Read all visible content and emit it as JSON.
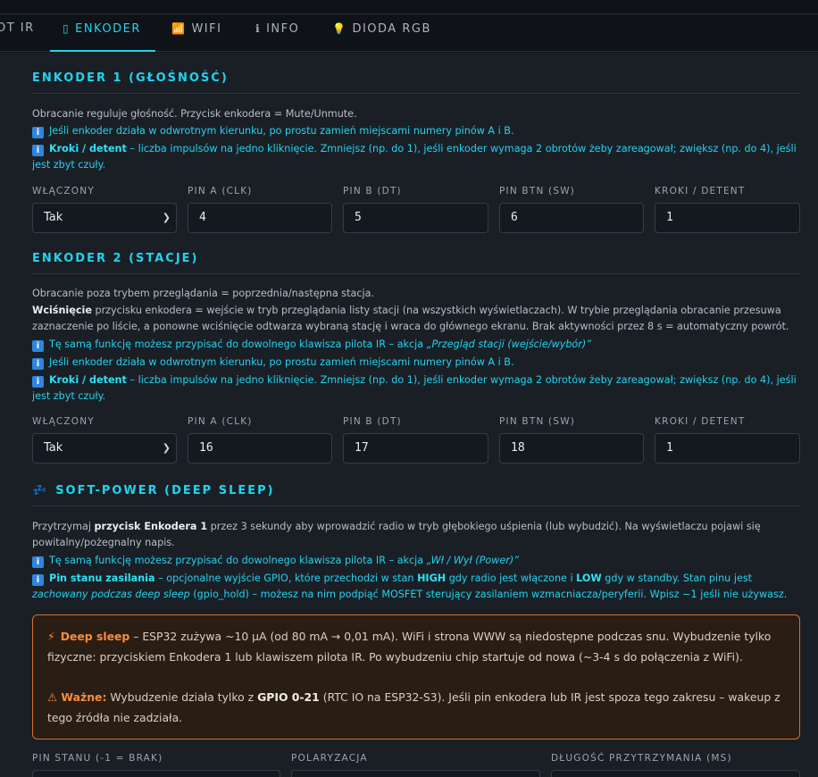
{
  "tabs": [
    {
      "label": "OT IR",
      "icon": ""
    },
    {
      "label": "ENKODER",
      "icon": "▯"
    },
    {
      "label": "WIFI",
      "icon": "📶"
    },
    {
      "label": "INFO",
      "icon": "ℹ"
    },
    {
      "label": "DIODA RGB",
      "icon": "💡"
    }
  ],
  "enc1": {
    "title": "ENKODER 1 (GŁOŚNOŚĆ)",
    "desc": "Obracanie reguluje głośność. Przycisk enkodera = Mute/Unmute.",
    "hint_reverse": "Jeśli enkoder działa w odwrotnym kierunku, po prostu zamień miejscami numery pinów A i B.",
    "hint_steps_bold": "Kroki / detent",
    "hint_steps": " – liczba impulsów na jedno kliknięcie. Zmniejsz (np. do 1), jeśli enkoder wymaga 2 obrotów żeby zareagował; zwiększ (np. do 4), jeśli jest zbyt czuły.",
    "labels": [
      "WŁĄCZONY",
      "PIN A (CLK)",
      "PIN B (DT)",
      "PIN BTN (SW)",
      "KROKI / DETENT"
    ],
    "enabled": "Tak",
    "pin_a": "4",
    "pin_b": "5",
    "pin_btn": "6",
    "steps": "1"
  },
  "enc2": {
    "title": "ENKODER 2 (STACJE)",
    "desc": "Obracanie poza trybem przeglądania = poprzednia/następna stacja.",
    "press_bold": "Wciśnięcie",
    "press": " przycisku enkodera = wejście w tryb przeglądania listy stacji (na wszystkich wyświetlaczach). W trybie przeglądania obracanie przesuwa zaznaczenie po liście, a ponowne wciśnięcie odtwarza wybraną stację i wraca do głównego ekranu. Brak aktywności przez 8 s = automatyczny powrót.",
    "hint_remote": "Tę samą funkcję możesz przypisać do dowolnego klawisza pilota IR – akcja ",
    "hint_remote_action": "„Przegląd stacji (wejście/wybór)”",
    "hint_reverse": "Jeśli enkoder działa w odwrotnym kierunku, po prostu zamień miejscami numery pinów A i B.",
    "hint_steps_bold": "Kroki / detent",
    "hint_steps": " – liczba impulsów na jedno kliknięcie. Zmniejsz (np. do 1), jeśli enkoder wymaga 2 obrotów żeby zareagował; zwiększ (np. do 4), jeśli jest zbyt czuły.",
    "labels": [
      "WŁĄCZONY",
      "PIN A (CLK)",
      "PIN B (DT)",
      "PIN BTN (SW)",
      "KROKI / DETENT"
    ],
    "enabled": "Tak",
    "pin_a": "16",
    "pin_b": "17",
    "pin_btn": "18",
    "steps": "1"
  },
  "soft": {
    "icon": "💤",
    "title": "SOFT-POWER (DEEP SLEEP)",
    "desc_pre": "Przytrzymaj ",
    "desc_bold": "przycisk Enkodera 1",
    "desc_post": " przez 3 sekundy aby wprowadzić radio w tryb głębokiego uśpienia (lub wybudzić). Na wyświetlaczu pojawi się powitalny/pożegnalny napis.",
    "hint_remote": "Tę samą funkcję możesz przypisać do dowolnego klawisza pilota IR – akcja ",
    "hint_remote_action": "„Wł / Wył (Power)”",
    "pin_bold": "Pin stanu zasilania",
    "pin_1": " – opcjonalne wyjście GPIO, które przechodzi w stan ",
    "pin_high": "HIGH",
    "pin_2": " gdy radio jest włączone i ",
    "pin_low": "LOW",
    "pin_3": " gdy w standby. Stan pinu jest ",
    "pin_italic": "zachowany podczas deep sleep",
    "pin_4": " (gpio_hold) – możesz na nim podpiąć MOSFET sterujący zasilaniem wzmacniacza/peryferii. Wpisz −1 jeśli nie używasz.",
    "warn_title": "Deep sleep",
    "warn_1": " – ESP32 zużywa ~10 µA (od 80 mA → 0,01 mA). WiFi i strona WWW są niedostępne podczas snu. Wybudzenie tylko fizyczne: przyciskiem Enkodera 1 lub klawiszem pilota IR. Po wybudzeniu chip startuje od nowa (~3-4 s do połączenia z WiFi).",
    "warn2_title": "⚠ Ważne:",
    "warn2_1": " Wybudzenie działa tylko z ",
    "warn2_bold": "GPIO 0-21",
    "warn2_2": " (RTC IO na ESP32-S3). Jeśli pin enkodera lub IR jest spoza tego zakresu – wakeup z tego źródła nie zadziała.",
    "labels": [
      "PIN STANU (-1 = BRAK)",
      "POLARYZACJA",
      "DŁUGOŚĆ PRZYTRZYMANIA (MS)"
    ]
  },
  "colors": {
    "accent": "#22d3ee",
    "warning": "#d9702a",
    "info_icon": "#2e86de"
  }
}
